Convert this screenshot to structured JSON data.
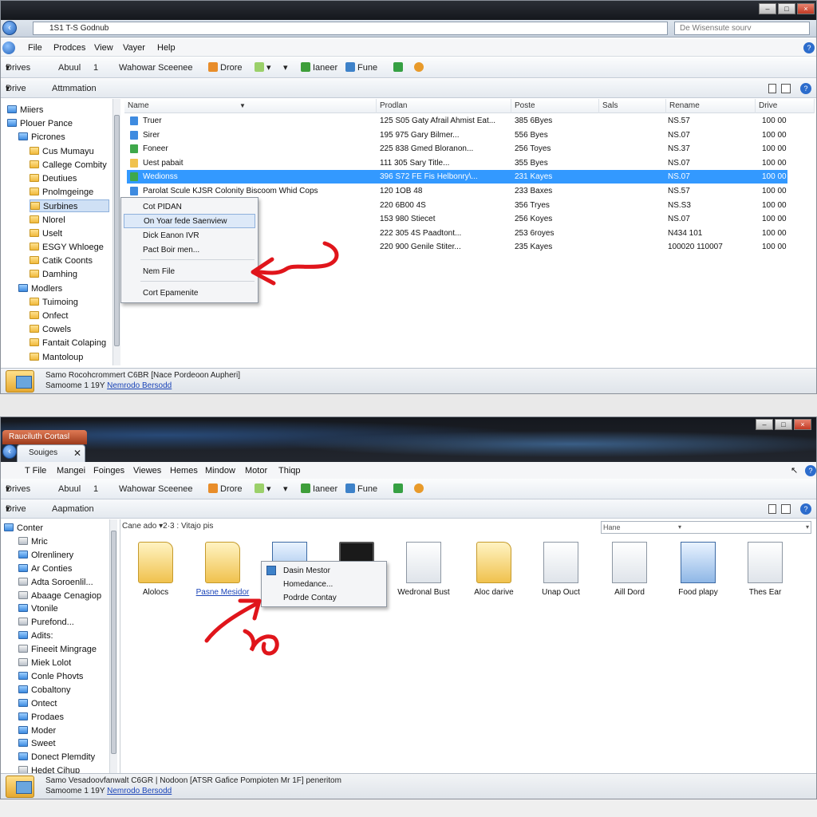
{
  "w1": {
    "addr": "1S1 T-S Godnub",
    "search": "De Wisensute sourv",
    "menu": [
      "File",
      "Prodces",
      "View",
      "Vayer",
      "Help"
    ],
    "toolbar": {
      "drives": "Drives",
      "about": "Abuul",
      "one": "1",
      "walkower": "Wahowar Sceenee",
      "drore": "Drore",
      "laneer": "Ianeer",
      "fune": "Fune"
    },
    "sub": {
      "drive": "Drive",
      "automation": "Attmmation"
    },
    "tree": [
      "Miiers",
      "Plouer Pance",
      "Picrones",
      "Cus Mumayu",
      "Callege Combity",
      "Deutiues",
      "Pnolmgeinge",
      "Surbines",
      "Nlorel",
      "Uselt",
      "ESGY Whloege",
      "Catik Coonts",
      "Damhing",
      "Modlers",
      "Tuimoing",
      "Onfect",
      "Cowels",
      "Fantait Colaping",
      "Mantoloup"
    ],
    "cols": [
      "Name",
      "Prodlan",
      "Poste",
      "Sals",
      "Rename",
      "Drive"
    ],
    "rows": [
      [
        "Truer",
        "125 S05 Gaty Afrail Ahmist Eat...",
        "385 6Byes",
        "NS.57",
        "100 00"
      ],
      [
        "Sirer",
        "195 975 Gary Bilmer...",
        "556 Byes",
        "NS.07",
        "100 00"
      ],
      [
        "Foneer",
        "225 838 Gmed Bloranon...",
        "256 Toyes",
        "NS.37",
        "100 00"
      ],
      [
        "Uest pabait",
        "111 305 Sary Title...",
        "355 Byes",
        "NS.07",
        "100 00"
      ],
      [
        "Wedionss",
        "396 S72 FE Fis Helbonry\\...",
        "231 Kayes",
        "NS.07",
        "100 00"
      ],
      [
        "Parolat Scule KJSR Colonity Biscoom Whid Cops",
        "120 1OB 48",
        "233 Baxes",
        "NS.57",
        "100 00"
      ],
      [
        "",
        "220 6B00 4S",
        "356 Tryes",
        "NS.S3",
        "100 00"
      ],
      [
        "",
        "153 980 Stiecet",
        "256 Koyes",
        "NS.07",
        "100 00"
      ],
      [
        "",
        "222 305 4S Paadtont...",
        "253 6royes",
        "N434 101",
        "100 00"
      ],
      [
        "",
        "220 900 Genile Stiter...",
        "235 Kayes",
        "100020 110007",
        "100 00"
      ]
    ],
    "ctx": [
      "Cot PIDAN",
      "On Yoar fede Saenview",
      "Dick Eanon IVR",
      "Pact Boir men...",
      "Nem File",
      "Cort Epamenite"
    ],
    "status1": "Samo Rocohcrommert C6BR [Nace Pordeoon Aupheri]",
    "status2a": "Samoome 1 19Y ",
    "status2b": "Nemrodo Bersodd"
  },
  "w2": {
    "topTab": "Rauciluth Cortasl",
    "tab": "Souiges",
    "menu": [
      "T File",
      "Mangei",
      "Foinges",
      "Viewes",
      "Hemes",
      "Mindow",
      "Motor",
      "Thiqp"
    ],
    "toolbar": {
      "drives": "Drives",
      "about": "Abuul",
      "one": "1",
      "walkower": "Wahowar Sceenee",
      "drore": "Drore",
      "laneer": "Ianeer",
      "fune": "Fune"
    },
    "sub": {
      "drive": "Drive",
      "automation": "Aapmation"
    },
    "path": "Cane ado  ▾2·3 : Vitajo pis",
    "viewbox": "Hane",
    "tree": [
      "Conter",
      "Mric",
      "Olrenlinery",
      "Ar Conties",
      "Adta Soroenlil...",
      "Abaage Cenagiop",
      "Vtonile",
      "Purefond...",
      "Adits:",
      "Fineeit Mingrage",
      "Miek Lolot",
      "Conle Phovts",
      "Cobaltony",
      "Ontect",
      "Prodaes",
      "Moder",
      "Sweet",
      "Donect Plemdity",
      "Hedet Cihup"
    ],
    "icons": [
      "Alolocs",
      "Pasne Mesidor",
      "",
      "",
      "Wedronal Bust",
      "Aloc darive",
      "Unap Ouct",
      "Aill Dord",
      "Food plapy",
      "Thes Ear"
    ],
    "ctx": [
      "Dasin Mestor",
      "Homedance...",
      "Podrde Contay"
    ],
    "status1": "Samo Vesadoovfanwalt C6GR | Nodoon [ATSR Gafice Pompioten Mr 1F] peneritom",
    "status2a": "Samoome 1 19Y ",
    "status2b": "Nemrodo Bersodd"
  },
  "colors": {
    "select": "#3399ff",
    "arrow": "#e0151b",
    "folder": "#f0c24e"
  }
}
